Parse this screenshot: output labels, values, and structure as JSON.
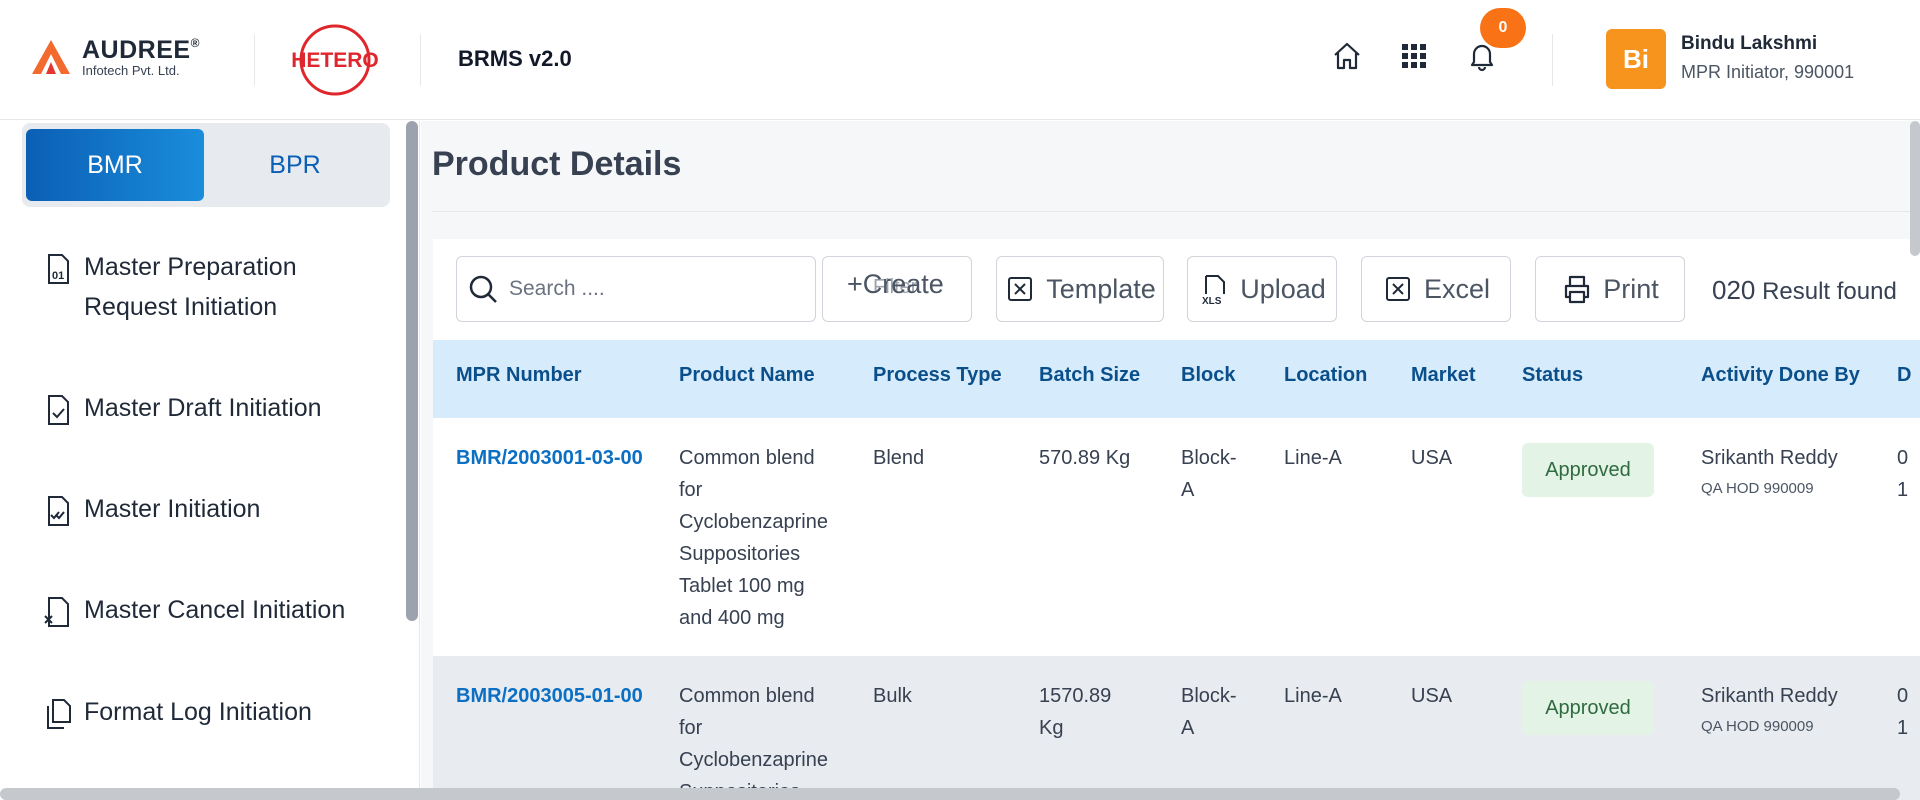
{
  "header": {
    "brand_name": "AUDREE",
    "brand_reg": "®",
    "brand_sub": "Infotech Pvt. Ltd.",
    "partner_logo": "HETERO",
    "app_name": "BRMS v2.0",
    "icons": [
      "home-icon",
      "apps-grid-icon",
      "bell-icon"
    ],
    "notification_count": "0",
    "user_initials": "Bi",
    "user_name": "Bindu Lakshmi",
    "user_role": "MPR Initiator, 990001",
    "accent_color": "#f7941d"
  },
  "sidebar": {
    "tabs": {
      "active": "BMR",
      "inactive": "BPR"
    },
    "items": [
      {
        "label": "Master Preparation Request Initiation",
        "icon": "document-01-icon"
      },
      {
        "label": "Master Draft Initiation",
        "icon": "document-check-icon"
      },
      {
        "label": "Master Initiation",
        "icon": "document-double-check-icon"
      },
      {
        "label": "Master Cancel Initiation",
        "icon": "document-cancel-icon"
      },
      {
        "label": "Format Log Initiation",
        "icon": "copy-documents-icon"
      }
    ]
  },
  "main": {
    "page_title": "Product Details",
    "search_placeholder": "Search ....",
    "filter_label": "Filter",
    "create_label": "Create",
    "template_label": "Template",
    "upload_label": "Upload",
    "excel_label": "Excel",
    "print_label": "Print",
    "result_count": "020",
    "result_text": "Result found",
    "columns": [
      "MPR Number",
      "Product Name",
      "Process Type",
      "Batch Size",
      "Block",
      "Location",
      "Market",
      "Status",
      "Activity Done By",
      "D"
    ],
    "rows": [
      {
        "mpr": "BMR/2003001-03-00",
        "product": "Common blend for Cyclobenzaprine Suppositories Tablet 100 mg and 400 mg",
        "process": "Blend",
        "batch": "570.89 Kg",
        "block": "Block-A",
        "location": "Line-A",
        "market": "USA",
        "status": "Approved",
        "by_name": "Srikanth Reddy",
        "by_role": "QA HOD 990009",
        "d1": "0",
        "d2": "1"
      },
      {
        "mpr": "BMR/2003005-01-00",
        "product": "Common blend for Cyclobenzaprine Suppositories",
        "process": "Bulk",
        "batch": "1570.89 Kg",
        "block": "Block-A",
        "location": "Line-A",
        "market": "USA",
        "status": "Approved",
        "by_name": "Srikanth Reddy",
        "by_role": "QA HOD 990009",
        "d1": "0",
        "d2": "1"
      }
    ]
  }
}
